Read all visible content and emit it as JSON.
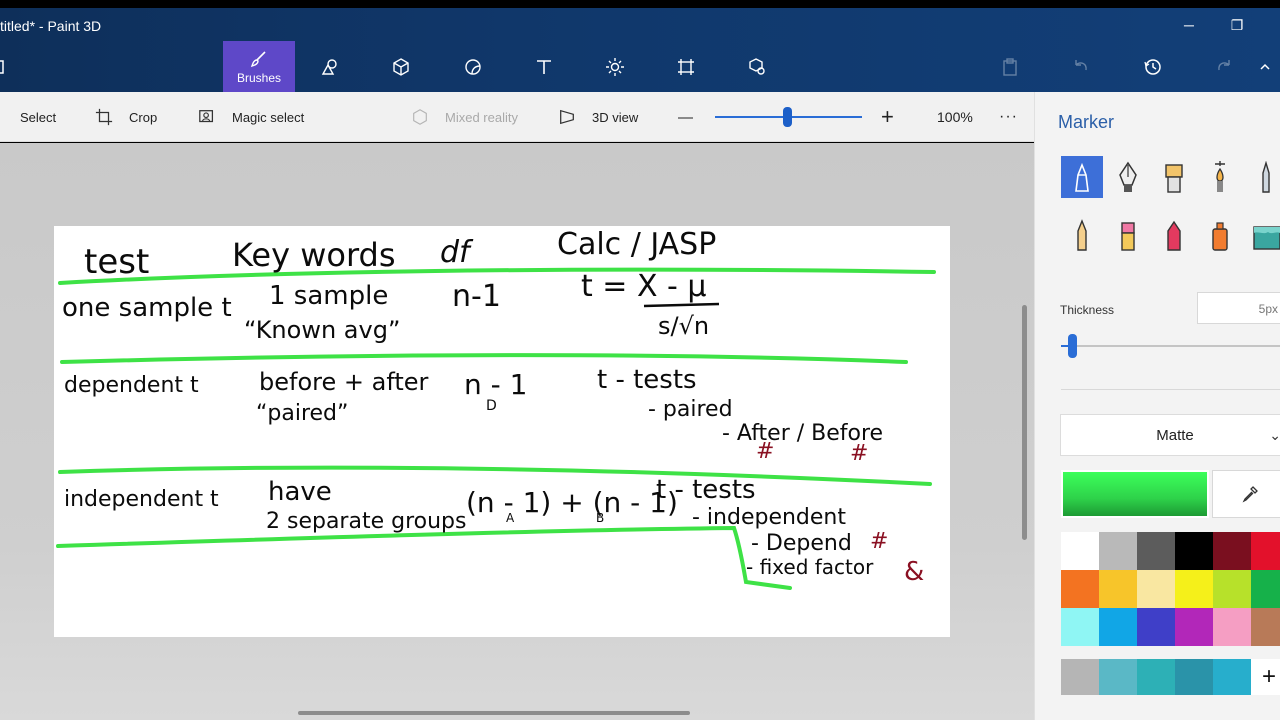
{
  "window": {
    "title": "titled* - Paint 3D",
    "minimize_glyph": "─",
    "restore_glyph": "❐"
  },
  "ribbon": {
    "active_tab_label": "Brushes",
    "icons": [
      "menu-icon",
      "brushes-icon",
      "2d-shapes-icon",
      "3d-shapes-icon",
      "stickers-icon",
      "text-icon",
      "effects-icon",
      "canvas-icon",
      "3d-library-icon",
      "paste-icon",
      "undo-icon",
      "history-icon",
      "redo-icon",
      "expand-icon"
    ]
  },
  "toolbar": {
    "select_label": "Select",
    "crop_label": "Crop",
    "magic_select_label": "Magic select",
    "mixed_reality_label": "Mixed reality",
    "view_3d_label": "3D view",
    "zoom_out_glyph": "—",
    "zoom_in_glyph": "+",
    "zoom_level": "100%",
    "more_glyph": "···"
  },
  "canvas": {
    "headers": [
      "test",
      "Key words",
      "df",
      "Calc / JASP"
    ],
    "rows": [
      {
        "test": "one sample t",
        "keywords": [
          "1 sample",
          "“Known avg”"
        ],
        "df": "n-1",
        "calc": [
          "t = X - μ",
          "s/√n"
        ]
      },
      {
        "test": "dependent t",
        "keywords": [
          "before + after",
          "“paired”"
        ],
        "df": "n - 1",
        "df_sub": "D",
        "calc": [
          "t - tests",
          "- paired",
          "- After / Before"
        ]
      },
      {
        "test": "independent t",
        "keywords": [
          "have",
          "2 separate groups"
        ],
        "df": "(n - 1) + (n - 1)",
        "df_sub": [
          "A",
          "B"
        ],
        "calc": [
          "t - tests",
          "- independent",
          "- Depend",
          "- fixed factor"
        ]
      }
    ],
    "marks": [
      "#",
      "#",
      "#",
      "&"
    ]
  },
  "panel": {
    "title": "Marker",
    "tools": [
      "marker-icon",
      "calligraphy-pen-icon",
      "oil-brush-icon",
      "watercolor-icon",
      "pencil-icon",
      "graphite-pencil-icon",
      "eraser-icon",
      "crayon-icon",
      "spray-can-icon",
      "fill-bucket-icon"
    ],
    "thickness_label": "Thickness",
    "thickness_value": "5px",
    "thickness_fraction": 0.04,
    "finish_value": "Matte",
    "current_color": "#2ed24a",
    "palette": [
      "#ffffff",
      "#b9b9b9",
      "#5c5c5c",
      "#000000",
      "#7a0f1f",
      "#e3112b",
      "#f37321",
      "#f7c52a",
      "#f9e7a1",
      "#f5f01a",
      "#b7e12a",
      "#16b14a",
      "#8ff6f4",
      "#11a6e6",
      "#3f3fc8",
      "#b227b9",
      "#f59ec3",
      "#b87a58",
      "#b5b5b5",
      "#5ab8c6",
      "#2db0b6",
      "#2a93a9",
      "#27aecc"
    ],
    "add_glyph": "+"
  }
}
